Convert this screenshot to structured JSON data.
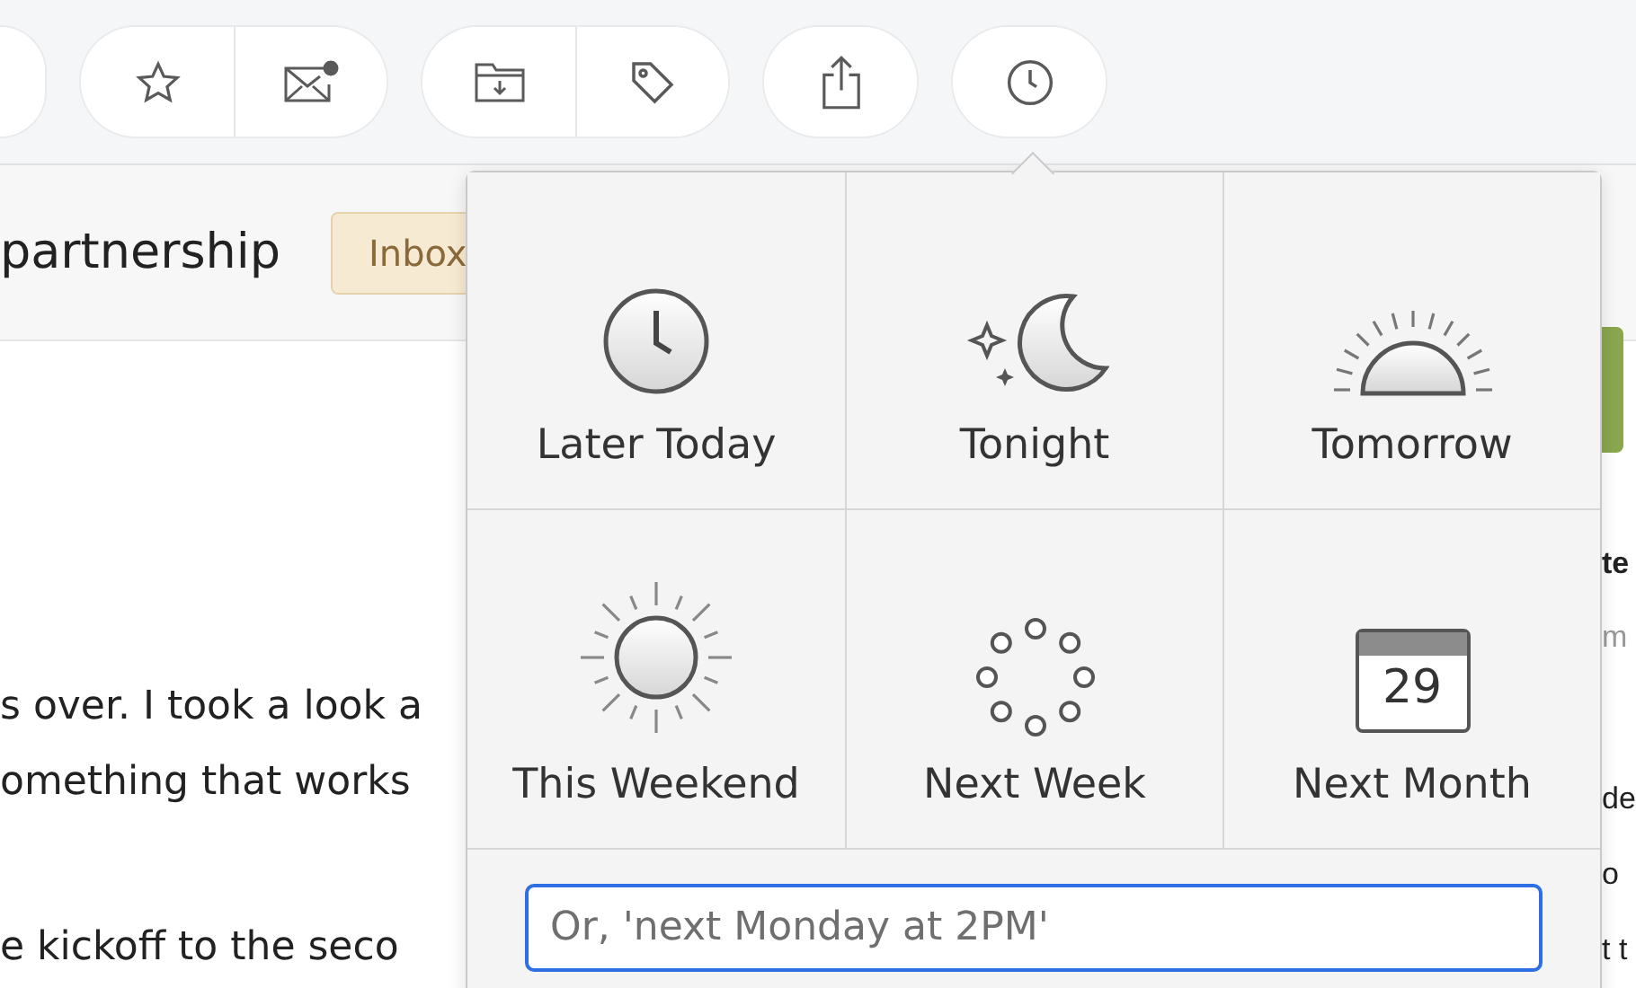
{
  "toolbar": {
    "groups": [
      {
        "buttons": [
          {
            "kind": "partial"
          }
        ]
      },
      {
        "buttons": [
          {
            "kind": "star"
          },
          {
            "kind": "mail"
          }
        ]
      },
      {
        "buttons": [
          {
            "kind": "folder"
          },
          {
            "kind": "tag"
          }
        ]
      },
      {
        "buttons": [
          {
            "kind": "share"
          }
        ]
      },
      {
        "buttons": [
          {
            "kind": "clock"
          }
        ]
      }
    ]
  },
  "subject": {
    "title": "partnership",
    "badge": "Inbox"
  },
  "body_lines": [
    "s over. I took a look a",
    "omething that works",
    "e kickoff to the seco"
  ],
  "side_pane": {
    "lines": [
      {
        "kind": "heading",
        "text": "te"
      },
      {
        "kind": "meta",
        "text": "m"
      },
      {
        "kind": "text",
        "text": "de"
      },
      {
        "kind": "text",
        "text": "o"
      },
      {
        "kind": "text",
        "text": "t t"
      }
    ]
  },
  "snooze_menu": {
    "options": [
      {
        "kind": "clock",
        "label": "Later Today"
      },
      {
        "kind": "moon",
        "label": "Tonight"
      },
      {
        "kind": "sunrise",
        "label": "Tomorrow"
      },
      {
        "kind": "sun",
        "label": "This Weekend"
      },
      {
        "kind": "dots",
        "label": "Next Week"
      },
      {
        "kind": "calendar",
        "label": "Next Month",
        "day": "29"
      }
    ],
    "input": {
      "placeholder": "Or, 'next Monday at 2PM'"
    }
  }
}
